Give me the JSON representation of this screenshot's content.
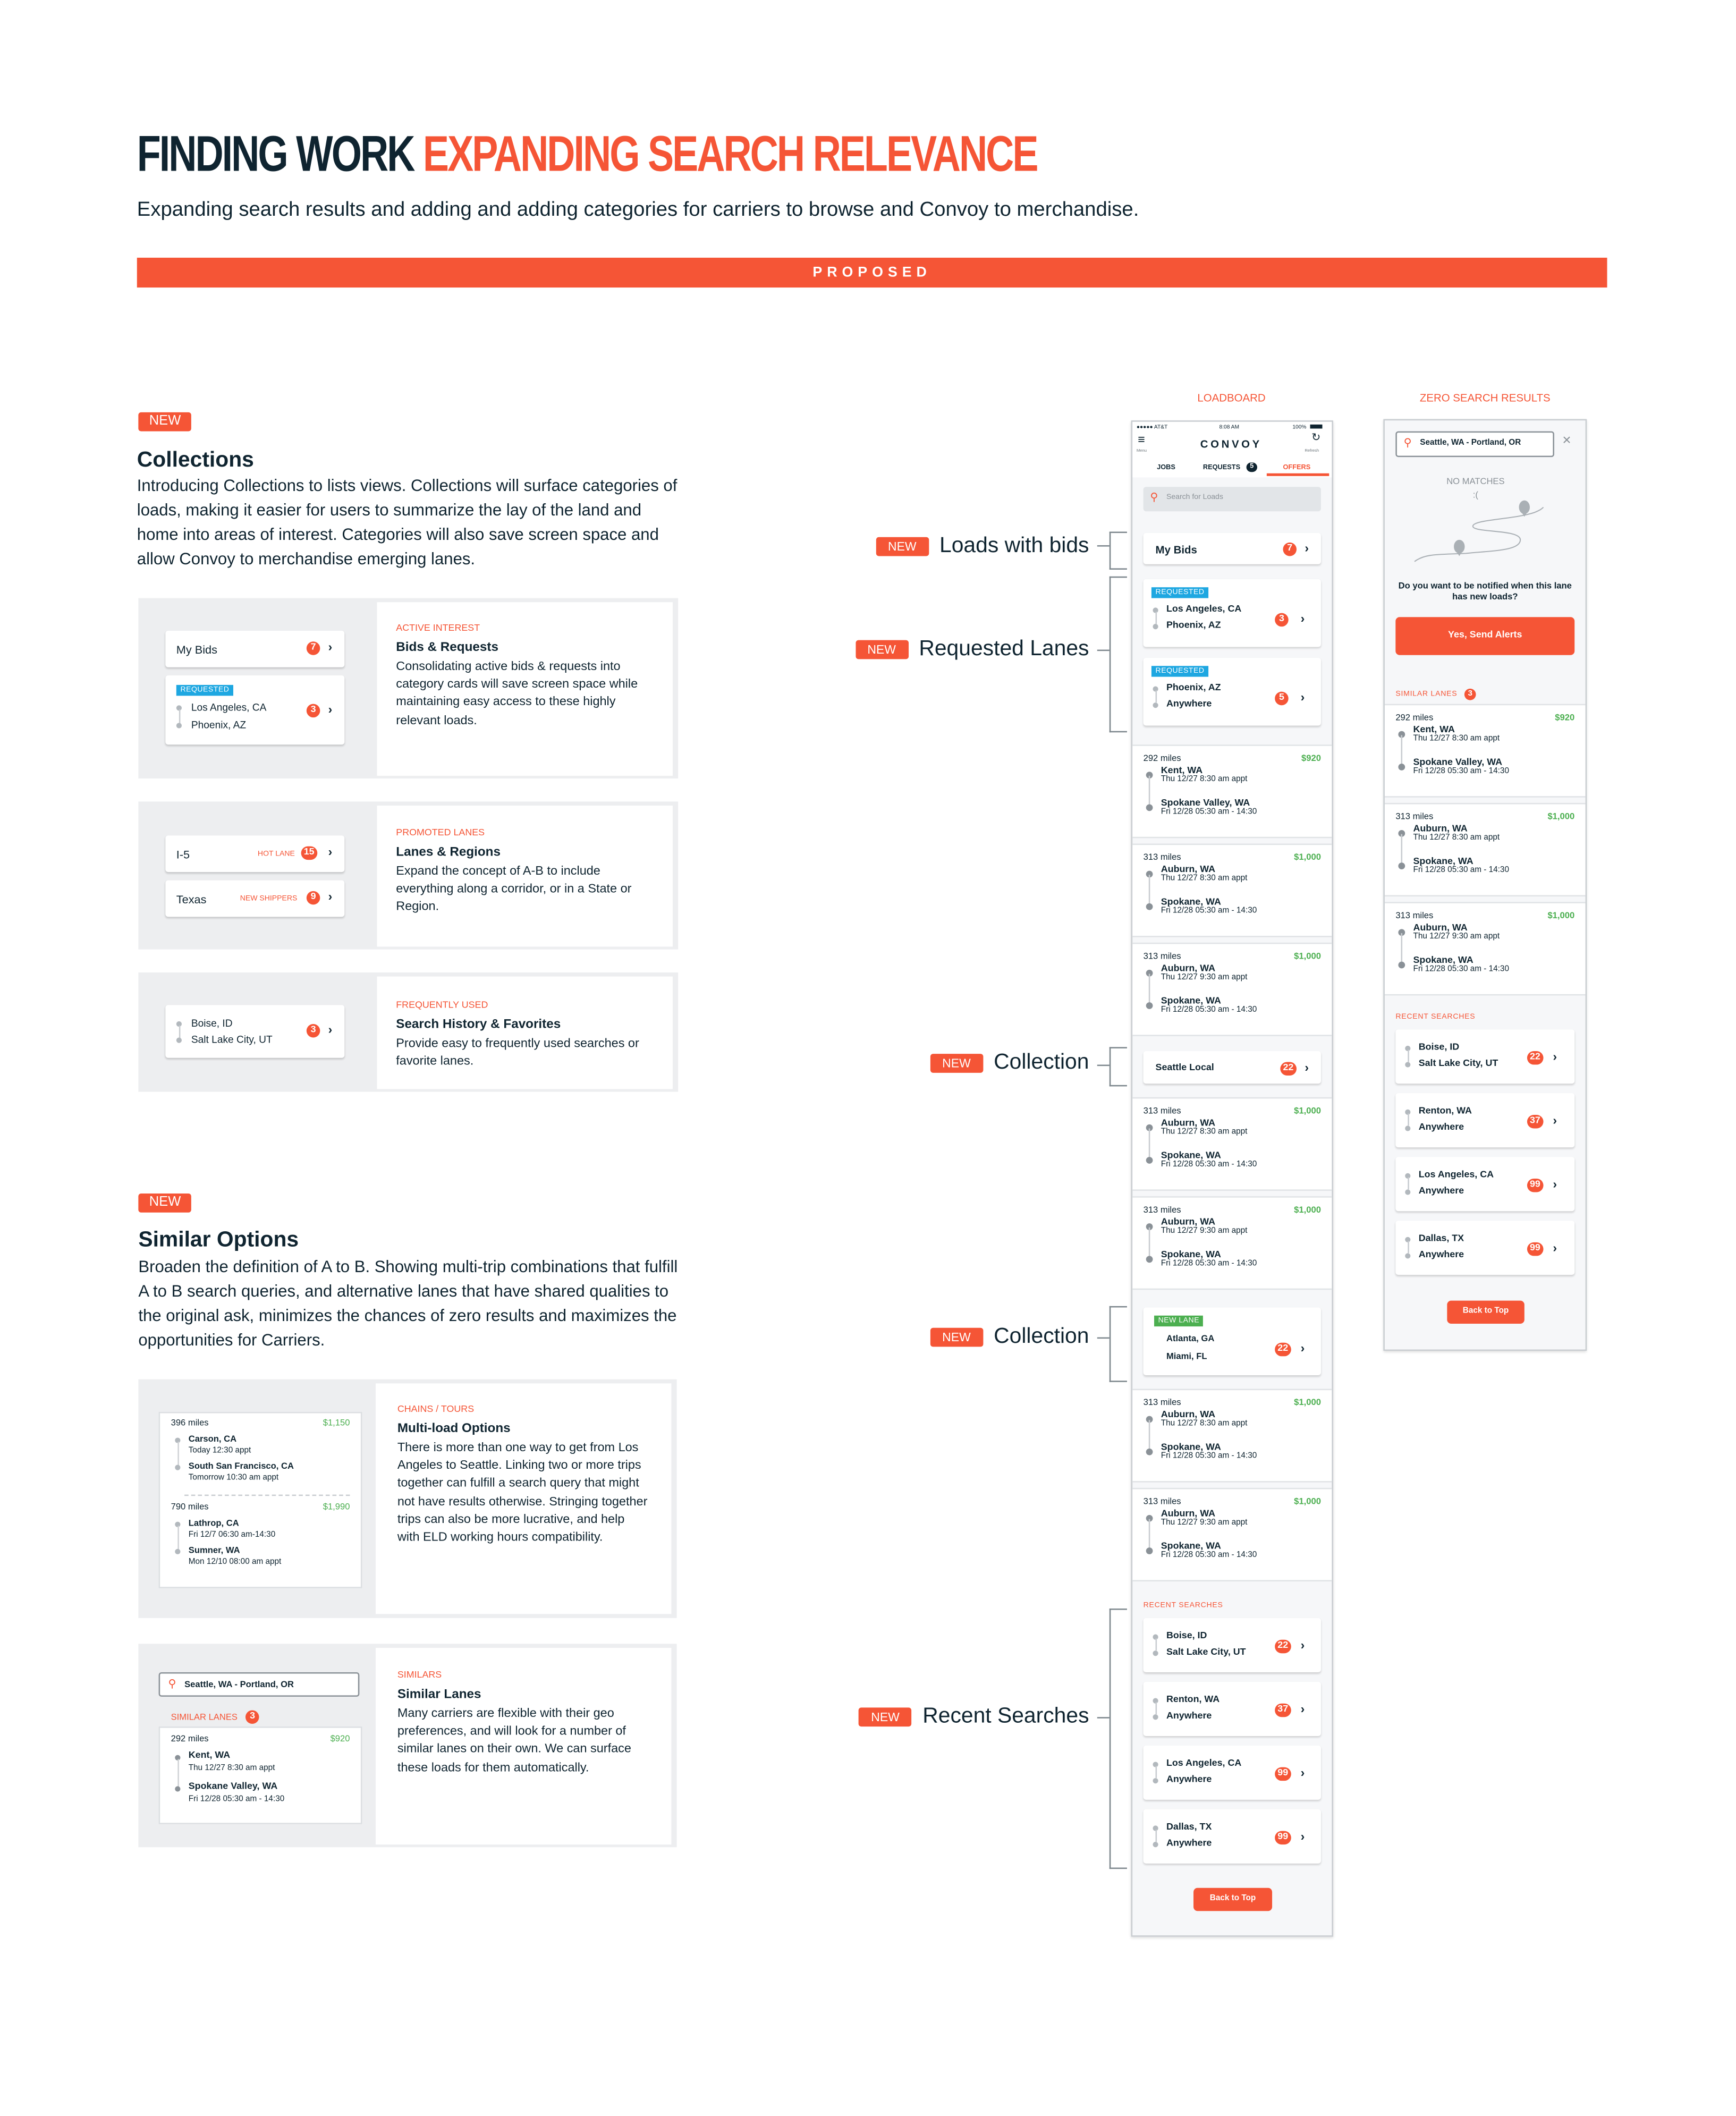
{
  "header": {
    "title_dark": "FINDING WORK",
    "title_accent": "EXPANDING SEARCH RELEVANCE",
    "subtitle": "Expanding search results and adding and adding categories for carriers to browse and Convoy to merchandise.",
    "banner": "PROPOSED"
  },
  "colors": {
    "accent": "#f55536",
    "ink": "#0f2430",
    "price_green": "#4caf50",
    "requested_blue": "#1ea7e1",
    "panel_gray": "#edeef0"
  },
  "new_tag": "NEW",
  "collections": {
    "title": "Collections",
    "description": "Introducing Collections to lists views. Collections will surface categories of loads, making it easier for users to summarize the lay of the land and home into areas of interest. Categories will also save screen space and allow Convoy to merchandise emerging lanes.",
    "panels": [
      {
        "eyebrow": "ACTIVE INTEREST",
        "title": "Bids & Requests",
        "description": "Consolidating active bids & requests into category cards will save screen space while maintaining easy access to these highly relevant loads.",
        "my_bids": {
          "label": "My Bids",
          "count": "7"
        },
        "requested": {
          "tag": "REQUESTED",
          "from": "Los Angeles, CA",
          "to": "Phoenix, AZ",
          "count": "3"
        }
      },
      {
        "eyebrow": "PROMOTED LANES",
        "title": "Lanes & Regions",
        "description": "Expand the concept of A-B to include everything along a corridor, or in a State or Region.",
        "lanes": [
          {
            "label": "I-5",
            "tag": "HOT LANE",
            "count": "15"
          },
          {
            "label": "Texas",
            "tag": "NEW SHIPPERS",
            "count": "9"
          }
        ]
      },
      {
        "eyebrow": "FREQUENTLY USED",
        "title": "Search History & Favorites",
        "description": "Provide easy to frequently used searches or favorite lanes.",
        "search": {
          "from": "Boise, ID",
          "to": "Salt Lake City, UT",
          "count": "3"
        }
      }
    ]
  },
  "similar_options": {
    "title": "Similar Options",
    "description": "Broaden the definition of A to B. Showing multi-trip combinations that fulfill A to B search queries, and alternative lanes that have shared qualities to the original ask, minimizes the chances of zero results and maximizes the opportunities for Carriers.",
    "multiload": {
      "eyebrow": "CHAINS / TOURS",
      "title": "Multi-load Options",
      "description": "There is more than one way to get from Los Angeles to Seattle. Linking two or more trips together can fulfill a search query that might not have results otherwise. Stringing together trips can also be more lucrative, and help with ELD working hours compatibility.",
      "legs": [
        {
          "miles": "396 miles",
          "price": "$1,150",
          "from": "Carson, CA",
          "from_time": "Today 12:30 appt",
          "to": "South San Francisco, CA",
          "to_time": "Tomorrow 10:30 am appt"
        },
        {
          "miles": "790 miles",
          "price": "$1,990",
          "from": "Lathrop, CA",
          "from_time": "Fri 12/7 06:30 am-14:30",
          "to": "Sumner, WA",
          "to_time": "Mon 12/10 08:00 am appt"
        }
      ]
    },
    "similars": {
      "eyebrow": "SIMILARS",
      "title": "Similar Lanes",
      "description": "Many carriers are flexible with their geo preferences, and will look for a number of similar lanes on their own.  We can surface these loads for them automatically.",
      "search_value": "Seattle, WA  - Portland, OR",
      "section_label": "SIMILAR LANES",
      "section_count": "3",
      "load": {
        "miles": "292 miles",
        "price": "$920",
        "from": "Kent, WA",
        "from_time": "Thu 12/27 8:30 am appt",
        "to": "Spokane Valley, WA",
        "to_time": "Fri 12/28 05:30 am - 14:30"
      }
    }
  },
  "annotations": [
    {
      "tag": "NEW",
      "label": "Loads with bids"
    },
    {
      "tag": "NEW",
      "label": "Requested Lanes"
    },
    {
      "tag": "NEW",
      "label": "Collection"
    },
    {
      "tag": "NEW",
      "label": "Collection"
    },
    {
      "tag": "NEW",
      "label": "Recent Searches"
    }
  ],
  "loadboard": {
    "column_label": "LOADBOARD",
    "status": {
      "carrier": "●●●●● AT&T",
      "time": "8:08 AM",
      "battery": "100%"
    },
    "brand": "CONVOY",
    "menu_label": "Menu",
    "refresh_label": "Refresh",
    "tabs": [
      {
        "label": "JOBS",
        "active": false
      },
      {
        "label": "REQUESTS",
        "count": "5",
        "active": false
      },
      {
        "label": "OFFERS",
        "active": true
      }
    ],
    "search_placeholder": "Search for Loads",
    "my_bids": {
      "label": "My Bids",
      "count": "7"
    },
    "requested": [
      {
        "tag": "REQUESTED",
        "from": "Los Angeles, CA",
        "to": "Phoenix, AZ",
        "count": "3"
      },
      {
        "tag": "REQUESTED",
        "from": "Phoenix, AZ",
        "to": "Anywhere",
        "count": "5"
      }
    ],
    "loads_a": [
      {
        "miles": "292 miles",
        "price": "$920",
        "from": "Kent, WA",
        "from_time": "Thu 12/27 8:30 am appt",
        "to": "Spokane Valley, WA",
        "to_time": "Fri 12/28 05:30 am - 14:30"
      },
      {
        "miles": "313 miles",
        "price": "$1,000",
        "from": "Auburn, WA",
        "from_time": "Thu 12/27 8:30 am appt",
        "to": "Spokane, WA",
        "to_time": "Fri 12/28 05:30 am - 14:30"
      },
      {
        "miles": "313 miles",
        "price": "$1,000",
        "from": "Auburn, WA",
        "from_time": "Thu 12/27 9:30 am appt",
        "to": "Spokane, WA",
        "to_time": "Fri 12/28 05:30 am - 14:30"
      }
    ],
    "collection_1": {
      "label": "Seattle Local",
      "count": "22"
    },
    "loads_b": [
      {
        "miles": "313 miles",
        "price": "$1,000",
        "from": "Auburn, WA",
        "from_time": "Thu 12/27 8:30 am appt",
        "to": "Spokane, WA",
        "to_time": "Fri 12/28 05:30 am - 14:30"
      },
      {
        "miles": "313 miles",
        "price": "$1,000",
        "from": "Auburn, WA",
        "from_time": "Thu 12/27 9:30 am appt",
        "to": "Spokane, WA",
        "to_time": "Fri 12/28 05:30 am - 14:30"
      }
    ],
    "collection_2": {
      "tag": "NEW LANE",
      "from": "Atlanta, GA",
      "to": "Miami, FL",
      "count": "22"
    },
    "loads_c": [
      {
        "miles": "313 miles",
        "price": "$1,000",
        "from": "Auburn, WA",
        "from_time": "Thu 12/27 8:30 am appt",
        "to": "Spokane, WA",
        "to_time": "Fri 12/28 05:30 am - 14:30"
      },
      {
        "miles": "313 miles",
        "price": "$1,000",
        "from": "Auburn, WA",
        "from_time": "Thu 12/27 9:30 am appt",
        "to": "Spokane, WA",
        "to_time": "Fri 12/28 05:30 am - 14:30"
      }
    ],
    "recent_label": "RECENT SEARCHES",
    "recent": [
      {
        "from": "Boise, ID",
        "to": "Salt Lake City, UT",
        "count": "22"
      },
      {
        "from": "Renton, WA",
        "to": "Anywhere",
        "count": "37"
      },
      {
        "from": "Los Angeles, CA",
        "to": "Anywhere",
        "count": "99"
      },
      {
        "from": "Dallas, TX",
        "to": "Anywhere",
        "count": "99"
      }
    ],
    "back_to_top": "Back to Top"
  },
  "zero_results": {
    "column_label": "ZERO SEARCH RESULTS",
    "search_value": "Seattle, WA  - Portland, OR",
    "no_matches": "NO MATCHES",
    "sad_face": ":(",
    "prompt": "Do you want to be notified when this lane has new loads?",
    "alert_button": "Yes, Send Alerts",
    "similar_label": "SIMILAR LANES",
    "similar_count": "3",
    "similar": [
      {
        "miles": "292 miles",
        "price": "$920",
        "from": "Kent, WA",
        "from_time": "Thu 12/27 8:30 am appt",
        "to": "Spokane Valley, WA",
        "to_time": "Fri 12/28 05:30 am - 14:30"
      },
      {
        "miles": "313 miles",
        "price": "$1,000",
        "from": "Auburn, WA",
        "from_time": "Thu 12/27 8:30 am appt",
        "to": "Spokane, WA",
        "to_time": "Fri 12/28 05:30 am - 14:30"
      },
      {
        "miles": "313 miles",
        "price": "$1,000",
        "from": "Auburn, WA",
        "from_time": "Thu 12/27 9:30 am appt",
        "to": "Spokane, WA",
        "to_time": "Fri 12/28 05:30 am - 14:30"
      }
    ],
    "recent_label": "RECENT SEARCHES",
    "recent": [
      {
        "from": "Boise, ID",
        "to": "Salt Lake City, UT",
        "count": "22"
      },
      {
        "from": "Renton, WA",
        "to": "Anywhere",
        "count": "37"
      },
      {
        "from": "Los Angeles, CA",
        "to": "Anywhere",
        "count": "99"
      },
      {
        "from": "Dallas, TX",
        "to": "Anywhere",
        "count": "99"
      }
    ],
    "back_to_top": "Back to Top"
  }
}
